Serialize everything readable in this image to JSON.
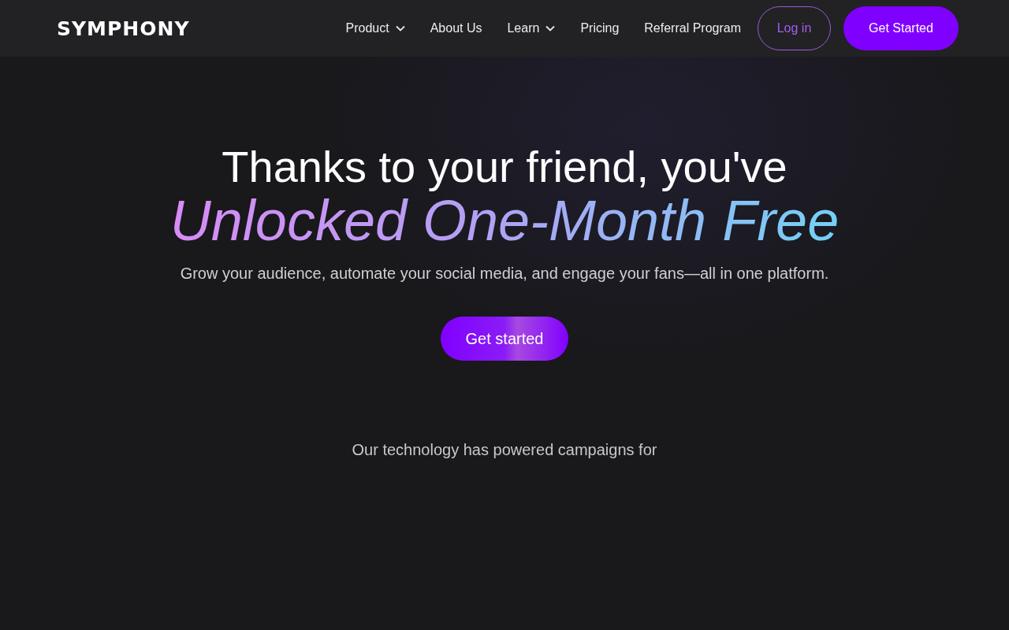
{
  "header": {
    "logo": "SYMPHONY",
    "nav": [
      {
        "label": "Product",
        "has_menu": true
      },
      {
        "label": "About Us",
        "has_menu": false
      },
      {
        "label": "Learn",
        "has_menu": true
      },
      {
        "label": "Pricing",
        "has_menu": false
      },
      {
        "label": "Referral Program",
        "has_menu": false
      }
    ],
    "login": "Log in",
    "cta": "Get Started"
  },
  "hero": {
    "title": "Thanks to your friend, you've",
    "highlight": "Unlocked One-Month Free",
    "subtitle": "Grow your audience, automate your social media, and engage your fans—all in one platform.",
    "button": "Get started"
  },
  "social_proof": {
    "caption": "Our technology has powered campaigns for"
  }
}
